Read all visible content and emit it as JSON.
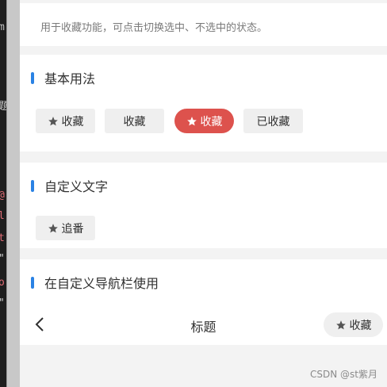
{
  "description": "用于收藏功能，可点击切换选中、不选中的状态。",
  "sections": [
    {
      "title": "基本用法",
      "buttons": [
        {
          "label": "收藏",
          "icon": "star-icon"
        },
        {
          "label": "收藏",
          "icon": null
        },
        {
          "label": "收藏",
          "icon": "star-icon",
          "state": "selected"
        },
        {
          "label": "已收藏",
          "icon": null
        }
      ]
    },
    {
      "title": "自定义文字",
      "buttons": [
        {
          "label": "追番",
          "icon": "star-icon"
        }
      ]
    },
    {
      "title": "在自定义导航栏使用",
      "navbar": {
        "back_icon": "chevron-left-icon",
        "title": "标题",
        "favorite_button": {
          "label": "收藏",
          "icon": "star-icon"
        }
      }
    }
  ],
  "watermark": "CSDN @st紫月",
  "colors": {
    "accent_bar": "#2a82e4",
    "favorite_active": "#dd524d",
    "button_bg": "#efefef",
    "star_gray": "#555555"
  }
}
